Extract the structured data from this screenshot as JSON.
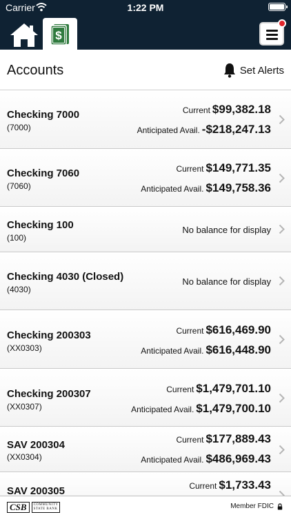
{
  "status": {
    "carrier": "Carrier",
    "time": "1:22 PM"
  },
  "nav": {
    "menu_notification": true
  },
  "header": {
    "title": "Accounts",
    "set_alerts": "Set Alerts"
  },
  "accounts": [
    {
      "name": "Checking 7000",
      "number": "(7000)",
      "current_label": "Current",
      "current": "$99,382.18",
      "avail_label": "Anticipated Avail.",
      "avail": "-$218,247.13"
    },
    {
      "name": "Checking 7060",
      "number": "(7060)",
      "current_label": "Current",
      "current": "$149,771.35",
      "avail_label": "Anticipated Avail.",
      "avail": "$149,758.36"
    },
    {
      "name": "Checking 100",
      "number": "(100)",
      "no_balance": "No balance for display"
    },
    {
      "name": "Checking 4030 (Closed)",
      "number": "(4030)",
      "no_balance": "No balance for display"
    },
    {
      "name": "Checking 200303",
      "number": "(XX0303)",
      "current_label": "Current",
      "current": "$616,469.90",
      "avail_label": "Anticipated Avail.",
      "avail": "$616,448.90"
    },
    {
      "name": "Checking 200307",
      "number": "(XX0307)",
      "current_label": "Current",
      "current": "$1,479,701.10",
      "avail_label": "Anticipated Avail.",
      "avail": "$1,479,700.10"
    },
    {
      "name": "SAV 200304",
      "number": "(XX0304)",
      "current_label": "Current",
      "current": "$177,889.43",
      "avail_label": "Anticipated Avail.",
      "avail": "$486,969.43"
    },
    {
      "name": "SAV 200305",
      "current_label": "Current",
      "current": "$1,733.43"
    }
  ],
  "footer": {
    "logo": {
      "initials": "CSB",
      "line1": "COMMUNITY",
      "line2": "STATE BANK"
    },
    "member_fdic": "Member FDIC"
  },
  "colors": {
    "header_bg": "#0f2233",
    "accent_green": "#2f7a3e",
    "notification_red": "#e1262d"
  }
}
